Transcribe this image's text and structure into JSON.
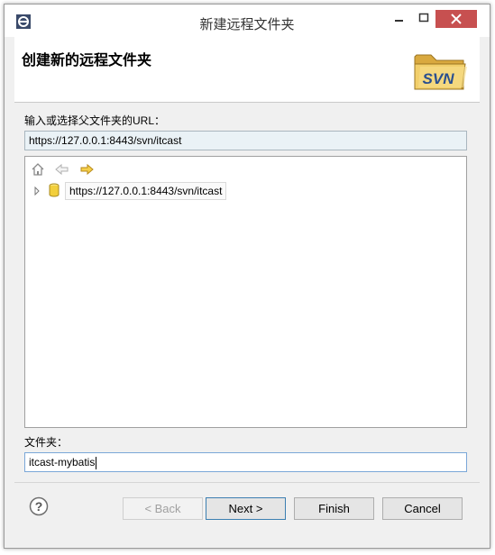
{
  "window": {
    "title": "新建远程文件夹",
    "close_color": "#c75050"
  },
  "header": {
    "title": "创建新的远程文件夹",
    "logo_text": "SVN"
  },
  "url_section": {
    "label": "输入或选择父文件夹的URL：",
    "value": "https://127.0.0.1:8443/svn/itcast"
  },
  "tree": {
    "toolbar_icons": [
      "home-icon",
      "back-arrow-icon",
      "forward-arrow-icon"
    ],
    "items": [
      {
        "label": "https://127.0.0.1:8443/svn/itcast",
        "icon": "repository-icon"
      }
    ]
  },
  "folder_section": {
    "label": "文件夹：",
    "value": "itcast-mybatis"
  },
  "buttons": {
    "back": "< Back",
    "next": "Next >",
    "finish": "Finish",
    "cancel": "Cancel"
  }
}
